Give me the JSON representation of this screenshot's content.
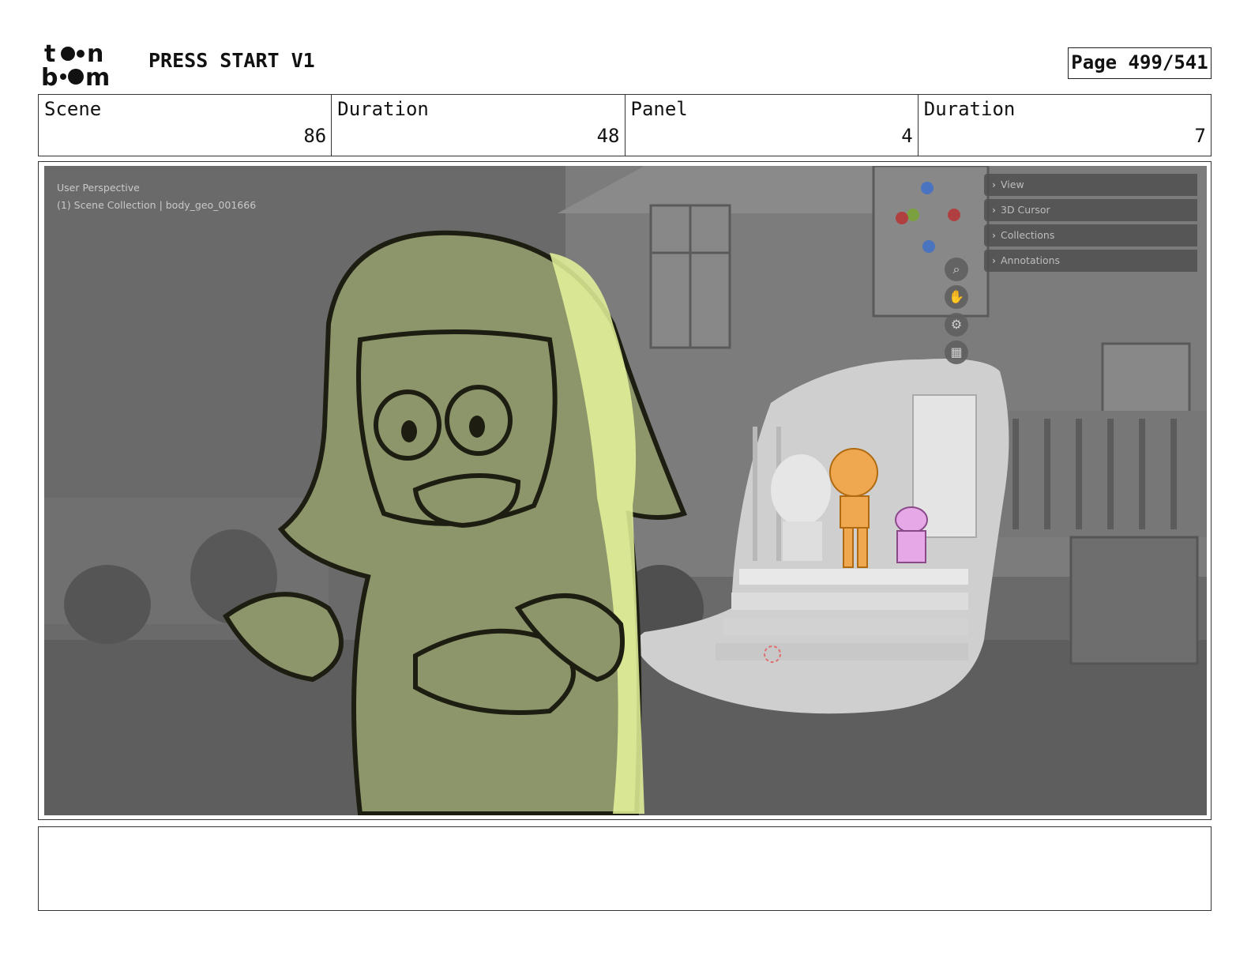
{
  "header": {
    "logo_text": "toon boom",
    "project_title": "PRESS START V1",
    "page_indicator": "Page 499/541"
  },
  "info": {
    "scene_label": "Scene",
    "scene_value": "86",
    "scene_duration_label": "Duration",
    "scene_duration_value": "48",
    "panel_label": "Panel",
    "panel_value": "4",
    "panel_duration_label": "Duration",
    "panel_duration_value": "7"
  },
  "viewport": {
    "perspective_label": "User Perspective",
    "collection_label": "(1) Scene Collection | body_geo_001666",
    "side_panels": [
      "View",
      "3D Cursor",
      "Collections",
      "Annotations"
    ],
    "nav_tools": [
      "zoom-icon",
      "hand-icon",
      "camera-icon",
      "grid-icon"
    ],
    "gizmo_axes": [
      "Z",
      "Y",
      "X"
    ]
  },
  "notes": {
    "text": ""
  },
  "colors": {
    "sketch_green": "#8c966a",
    "sketch_highlight": "#e6f59a",
    "boy_orange": "#f0a850",
    "dog_pink": "#e6a8e6",
    "viewport_bg": "#6b6b6b"
  }
}
